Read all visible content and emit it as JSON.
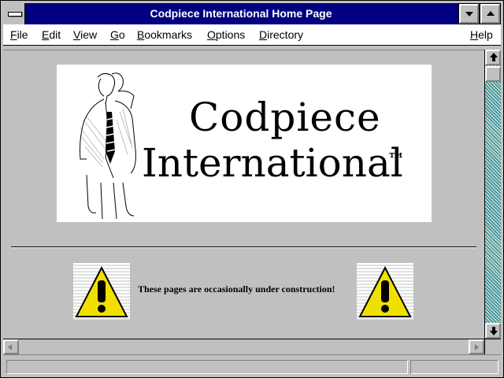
{
  "window": {
    "title": "Codpiece International Home Page"
  },
  "menubar": {
    "file": "File",
    "edit": "Edit",
    "view": "View",
    "go": "Go",
    "bookmarks": "Bookmarks",
    "options": "Options",
    "directory": "Directory",
    "help": "Help"
  },
  "banner": {
    "line1": "Codpiece",
    "line2": "International",
    "trademark": "™"
  },
  "notice": {
    "text": "These pages are occasionally under construction!"
  },
  "icons": {
    "system_menu": "system-menu-icon",
    "minimize": "minimize-icon",
    "maximize": "maximize-icon",
    "warning": "warning-triangle-icon",
    "scroll_up": "arrow-up-icon",
    "scroll_down": "arrow-down-icon",
    "scroll_left": "arrow-left-icon",
    "scroll_right": "arrow-right-icon"
  },
  "colors": {
    "titlebar": "#000080",
    "face": "#c0c0c0",
    "warning_yellow": "#f0e000",
    "scroll_track": "#008080"
  }
}
